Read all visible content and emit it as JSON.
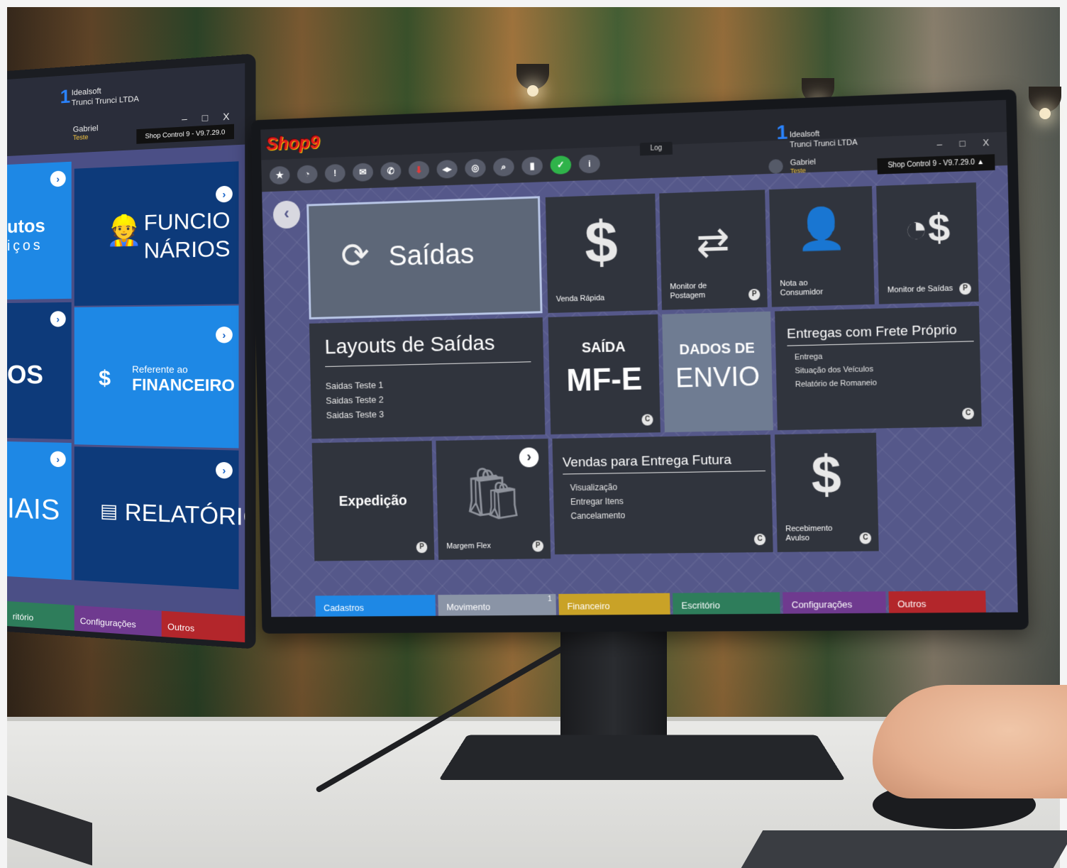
{
  "left_screen": {
    "company_line1": "Idealsoft",
    "company_line2": "Trunci Trunci LTDA",
    "company_number": "1",
    "user_name": "Gabriel",
    "user_role": "Teste",
    "version": "Shop Control 9 - V9.7.29.0",
    "window_controls": "– □ X",
    "tiles": [
      {
        "label_a": "utos",
        "label_b": "iços"
      },
      {
        "label_a": "FUNCIO",
        "label_b": "NÁRIOS"
      },
      {
        "label_a": "OS"
      },
      {
        "label_a": "Referente ao",
        "label_b": "FINANCEIRO"
      },
      {
        "label_a": "IAIS"
      },
      {
        "label_a": "RELATÓRIOS"
      }
    ],
    "tabs": [
      "ritório",
      "Configurações",
      "Outros"
    ]
  },
  "app": {
    "logo": "Shop9",
    "log_tab": "Log",
    "company_number": "1",
    "company_line1": "Idealsoft",
    "company_line2": "Trunci Trunci LTDA",
    "user_name": "Gabriel",
    "user_role": "Teste",
    "version": "Shop Control 9 - V9.7.29.0",
    "window_controls": "– □ X",
    "toolbar_icons": [
      {
        "name": "star-icon",
        "glyph": "★"
      },
      {
        "name": "speedometer-icon",
        "glyph": "◔"
      },
      {
        "name": "alert-icon",
        "glyph": "!"
      },
      {
        "name": "mail-icon",
        "glyph": "✉"
      },
      {
        "name": "whatsapp-icon",
        "glyph": "✆"
      },
      {
        "name": "download-icon",
        "glyph": "⬇"
      },
      {
        "name": "remote-access-icon",
        "glyph": "◂▸"
      },
      {
        "name": "instagram-icon",
        "glyph": "◎"
      },
      {
        "name": "search-icon",
        "glyph": "⌕"
      },
      {
        "name": "chart-icon",
        "glyph": "▮"
      },
      {
        "name": "check-icon",
        "glyph": "✓"
      },
      {
        "name": "info-icon",
        "glyph": "i"
      }
    ],
    "back_glyph": "‹",
    "tiles": {
      "saidas": "Saídas",
      "venda_rapida": "Venda Rápida",
      "monitor_postagem_1": "Monitor de",
      "monitor_postagem_2": "Postagem",
      "nota_consumidor_1": "Nota ao",
      "nota_consumidor_2": "Consumidor",
      "monitor_saidas": "Monitor de Saídas",
      "layouts_title": "Layouts de Saídas",
      "layouts_items": [
        "Saidas Teste 1",
        "Saidas Teste 2",
        "Saidas Teste 3"
      ],
      "saida_mfe_1": "SAÍDA",
      "saida_mfe_2": "MF-E",
      "dados_envio_1": "DADOS DE",
      "dados_envio_2": "ENVIO",
      "entregas_title": "Entregas com Frete Próprio",
      "entregas_items": [
        "Entrega",
        "Situação dos Veículos",
        "Relatório de Romaneio"
      ],
      "expedicao": "Expedição",
      "margem_flex": "Margem Flex",
      "vendas_futura_title": "Vendas para Entrega Futura",
      "vendas_futura_items": [
        "Visualização",
        "Entregar Itens",
        "Cancelamento"
      ],
      "recebimento_1": "Recebimento",
      "recebimento_2": "Avulso",
      "badge_c": "C",
      "badge_p": "P"
    },
    "tabs": [
      {
        "label": "Cadastros",
        "color": "#1e88e5"
      },
      {
        "label": "Movimento",
        "color": "#8a94a6",
        "count": "1"
      },
      {
        "label": "Financeiro",
        "color": "#c9a227"
      },
      {
        "label": "Escritório",
        "color": "#2e7d5b"
      },
      {
        "label": "Configurações",
        "color": "#6f3a8f"
      },
      {
        "label": "Outros",
        "color": "#b3262b"
      }
    ]
  }
}
